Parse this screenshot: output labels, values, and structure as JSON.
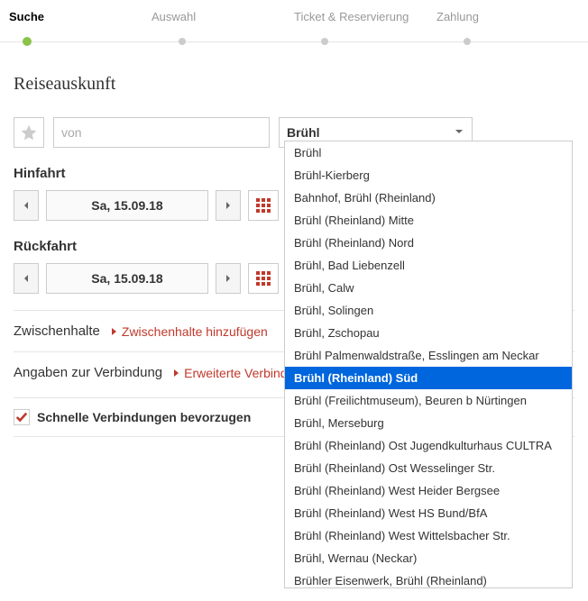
{
  "progress": {
    "steps": [
      "Suche",
      "Auswahl",
      "Ticket & Reservierung",
      "Zahlung"
    ]
  },
  "heading": "Reiseauskunft",
  "from": {
    "placeholder": "von",
    "value": ""
  },
  "to": {
    "typed": "Brühl"
  },
  "suggestions": {
    "selected_index": 10,
    "items": [
      "Brühl",
      "Brühl-Kierberg",
      "Bahnhof, Brühl (Rheinland)",
      "Brühl (Rheinland) Mitte",
      "Brühl (Rheinland) Nord",
      "Brühl, Bad Liebenzell",
      "Brühl, Calw",
      "Brühl, Solingen",
      "Brühl, Zschopau",
      "Brühl Palmenwaldstraße, Esslingen am Neckar",
      "Brühl (Rheinland) Süd",
      "Brühl (Freilichtmuseum), Beuren b Nürtingen",
      "Brühl, Merseburg",
      "Brühl (Rheinland) Ost Jugendkulturhaus CULTRA",
      "Brühl (Rheinland) Ost Wesselinger Str.",
      "Brühl (Rheinland) West Heider Bergsee",
      "Brühl (Rheinland) West HS Bund/BfA",
      "Brühl (Rheinland) West Wittelsbacher Str.",
      "Brühl, Wernau (Neckar)",
      "Brühler Eisenwerk, Brühl (Rheinland)"
    ]
  },
  "outbound": {
    "title": "Hinfahrt",
    "date": "Sa, 15.09.18"
  },
  "return": {
    "title": "Rückfahrt",
    "date": "Sa, 15.09.18"
  },
  "stopovers": {
    "label": "Zwischenhalte",
    "link": "Zwischenhalte hinzufügen"
  },
  "connection": {
    "label": "Angaben zur Verbindung",
    "link": "Erweiterte Verbindungsangaben"
  },
  "fast_connections": {
    "label": "Schnelle Verbindungen bevorzugen",
    "checked": true
  }
}
